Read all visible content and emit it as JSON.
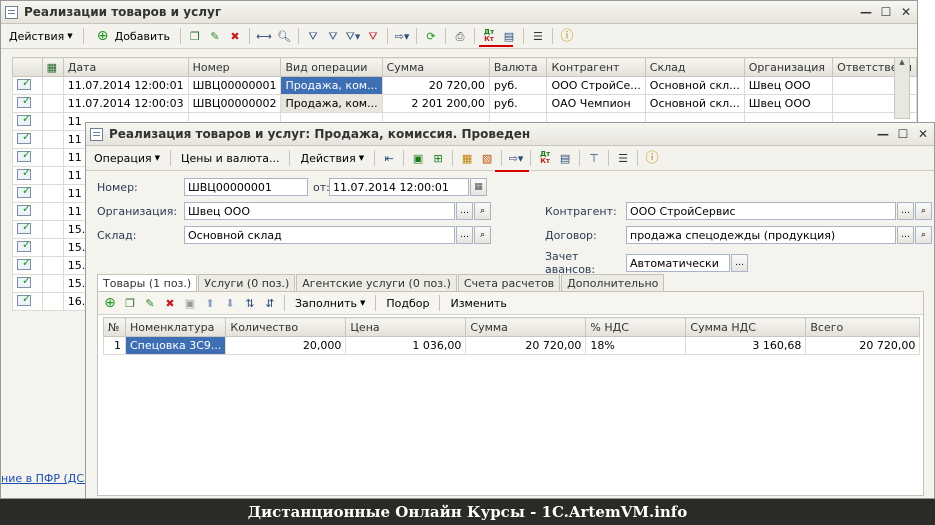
{
  "list_window": {
    "title": "Реализации товаров и услуг",
    "toolbar": {
      "actions_label": "Действия",
      "add_label": "Добавить"
    },
    "columns": [
      "Дата",
      "Номер",
      "Вид операции",
      "Сумма",
      "Валюта",
      "Контрагент",
      "Склад",
      "Организация",
      "Ответственн"
    ],
    "rows": [
      {
        "date": "11.07.2014 12:00:01",
        "number": "ШВЦ00000001",
        "op": "Продажа, ком...",
        "sum": "20 720,00",
        "cur": "руб.",
        "agent": "ООО СтройСе...",
        "store": "Основной скл...",
        "org": "Швец ООО"
      },
      {
        "date": "11.07.2014 12:00:03",
        "number": "ШВЦ00000002",
        "op": "Продажа, ком...",
        "sum": "2 201 200,00",
        "cur": "руб.",
        "agent": "ОАО Чемпион",
        "store": "Основной скл...",
        "org": "Швец ООО"
      }
    ],
    "partial_dates": [
      "11",
      "11",
      "11",
      "11",
      "11",
      "11",
      "15.",
      "15.",
      "15.",
      "15.",
      "16."
    ],
    "bottom_link": "ние в ПФР (ДСВ"
  },
  "doc_window": {
    "title": "Реализация товаров и услуг: Продажа, комиссия. Проведен",
    "toolbar": {
      "operation_label": "Операция",
      "prices_label": "Цены и валюта...",
      "actions_label": "Действия"
    },
    "fields": {
      "number_label": "Номер:",
      "number_value": "ШВЦ00000001",
      "from_label": "от:",
      "date_value": "11.07.2014 12:00:01",
      "org_label": "Организация:",
      "org_value": "Швец ООО",
      "store_label": "Склад:",
      "store_value": "Основной склад",
      "agent_label": "Контрагент:",
      "agent_value": "ООО СтройСервис",
      "contract_label": "Договор:",
      "contract_value": "продажа спецодежды (продукция)",
      "advance_label": "Зачет авансов:",
      "advance_value": "Автоматически"
    },
    "tabs": [
      "Товары (1 поз.)",
      "Услуги (0 поз.)",
      "Агентские услуги (0 поз.)",
      "Счета расчетов",
      "Дополнительно"
    ],
    "table_toolbar": {
      "fill_label": "Заполнить",
      "pick_label": "Подбор",
      "change_label": "Изменить"
    },
    "columns": [
      "№",
      "Номенклатура",
      "Количество",
      "Цена",
      "Сумма",
      "% НДС",
      "Сумма НДС",
      "Всего"
    ],
    "rows": [
      {
        "n": "1",
        "item": "Спецовка 3С9...",
        "qty": "20,000",
        "price": "1 036,00",
        "sum": "20 720,00",
        "vat": "18%",
        "vat_sum": "3 160,68",
        "total": "20 720,00"
      }
    ]
  },
  "footer": {
    "text": "Дистанционные Онлайн Курсы - 1C.ArtemVM.info"
  },
  "colors": {
    "accent_red": "#d40000",
    "selection": "#3e6fb4"
  }
}
